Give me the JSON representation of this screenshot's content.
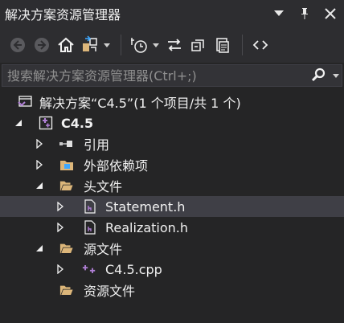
{
  "window": {
    "title": "解决方案资源管理器",
    "controls": {
      "menu_icon": "dropdown-icon",
      "pin_icon": "pin-icon",
      "close_icon": "close-icon"
    }
  },
  "toolbar": {
    "buttons": [
      "back-icon",
      "forward-icon",
      "home-icon",
      "switch-views-icon",
      "pending-changes-filter-icon",
      "sync-icon",
      "collapse-all-icon",
      "show-all-files-icon",
      "code-view-icon"
    ]
  },
  "search": {
    "placeholder": "搜索解决方案资源管理器(Ctrl+;)"
  },
  "tree": {
    "solution_label": "解决方案“C4.5”(1 个项目/共 1 个)",
    "project_label": "C4.5",
    "references_label": "引用",
    "external_deps_label": "外部依赖项",
    "header_files_label": "头文件",
    "statement_h": "Statement.h",
    "realization_h": "Realization.h",
    "source_files_label": "源文件",
    "c45_cpp": "C4.5.cpp",
    "resource_files_label": "资源文件"
  },
  "colors": {
    "background": "#252526",
    "toolbar": "#2d2d30",
    "selection": "#3f3f46",
    "text": "#f1f1f1",
    "folder": "#dcb67a",
    "project_accent": "#b180d7"
  }
}
